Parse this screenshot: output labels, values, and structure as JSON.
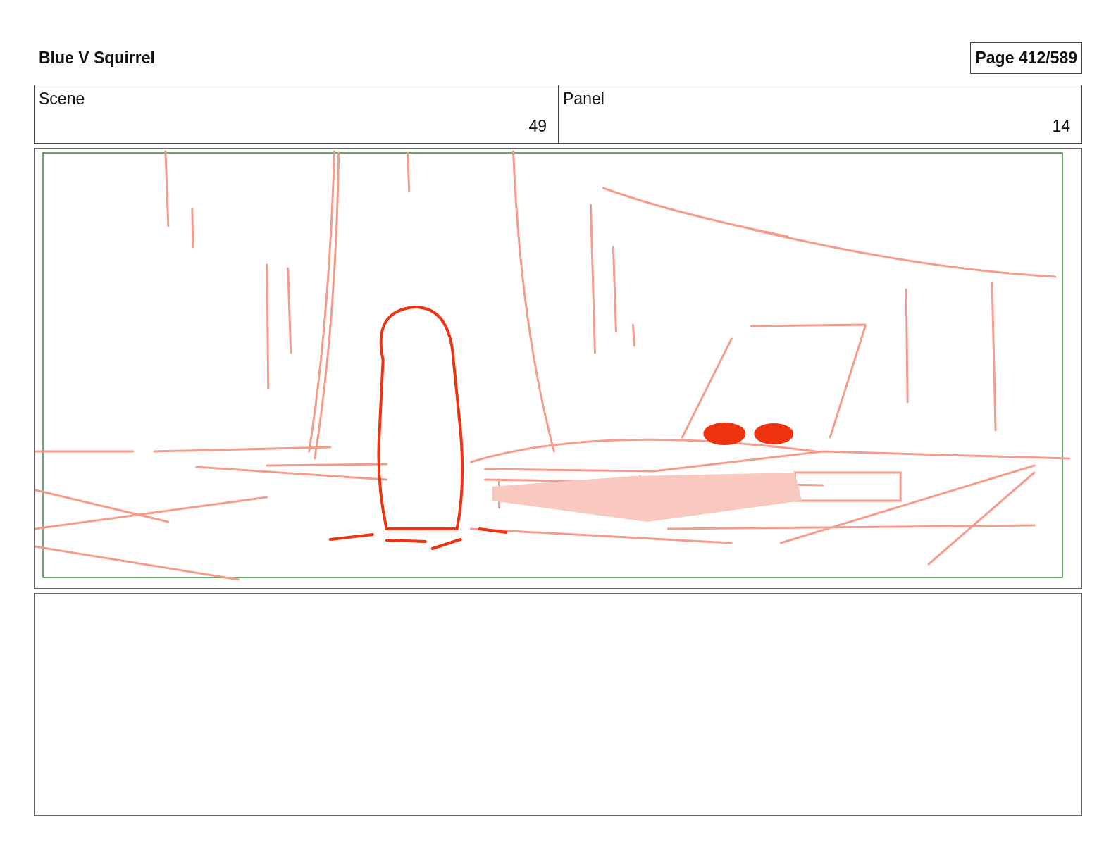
{
  "title": "Blue V Squirrel",
  "page_label": "Page 412/589",
  "fields": [
    {
      "label": "Scene",
      "value": "49"
    },
    {
      "label": "Panel",
      "value": "14"
    }
  ]
}
